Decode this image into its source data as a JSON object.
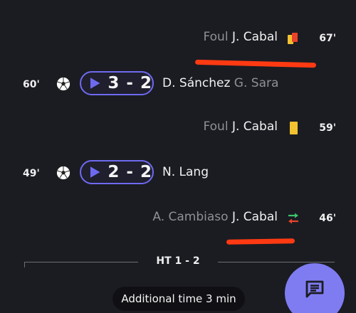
{
  "colors": {
    "background": "#1b1c22",
    "accent": "#6e6af0",
    "fab": "#7f7cf2",
    "annotation": "#ff3a12",
    "yellow_card": "#f2c230",
    "red_card": "#e8432a"
  },
  "events": [
    {
      "side": "away",
      "type": "second-yellow-red-card",
      "minute": "67'",
      "label": "Foul",
      "player": "J. Cabal",
      "icon": "yellow-red-card-icon"
    },
    {
      "side": "home",
      "type": "goal",
      "minute": "60'",
      "score": "3 - 2",
      "scorer": "D. Sánchez",
      "assist": "G. Sara",
      "icon": "soccer-ball-icon"
    },
    {
      "side": "away",
      "type": "yellow-card",
      "minute": "59'",
      "label": "Foul",
      "player": "J. Cabal",
      "icon": "yellow-card-icon"
    },
    {
      "side": "home",
      "type": "goal",
      "minute": "49'",
      "score": "2 - 2",
      "scorer": "N. Lang",
      "assist": "",
      "icon": "soccer-ball-icon"
    },
    {
      "side": "away",
      "type": "substitution",
      "minute": "46'",
      "player_out": "A. Cambiaso",
      "player_in": "J. Cabal",
      "icon": "substitution-icon"
    }
  ],
  "halftime": {
    "label": "HT 1 - 2"
  },
  "added_time": {
    "label": "Additional time 3 min"
  },
  "fab": {
    "icon": "chat-icon"
  }
}
